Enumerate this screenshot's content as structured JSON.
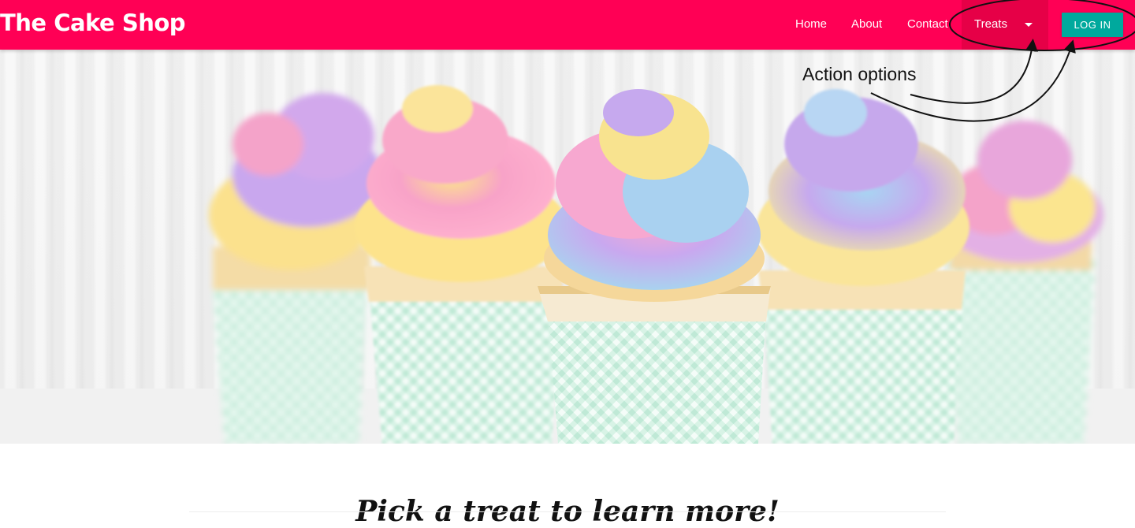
{
  "brand": {
    "title": "The Cake Shop"
  },
  "nav": {
    "links": [
      "Home",
      "About",
      "Contact"
    ],
    "dropdown": {
      "label": "Treats",
      "icon": "caret-down-icon"
    },
    "login_label": "LOG IN"
  },
  "annotation": {
    "text": "Action options"
  },
  "hero": {
    "image": "cupcakes-photo"
  },
  "main": {
    "title": "Pick a treat to learn more!"
  },
  "colors": {
    "navbar": "#ff0055",
    "dropdown_active": "#e60047",
    "login_button": "#00a99d"
  }
}
